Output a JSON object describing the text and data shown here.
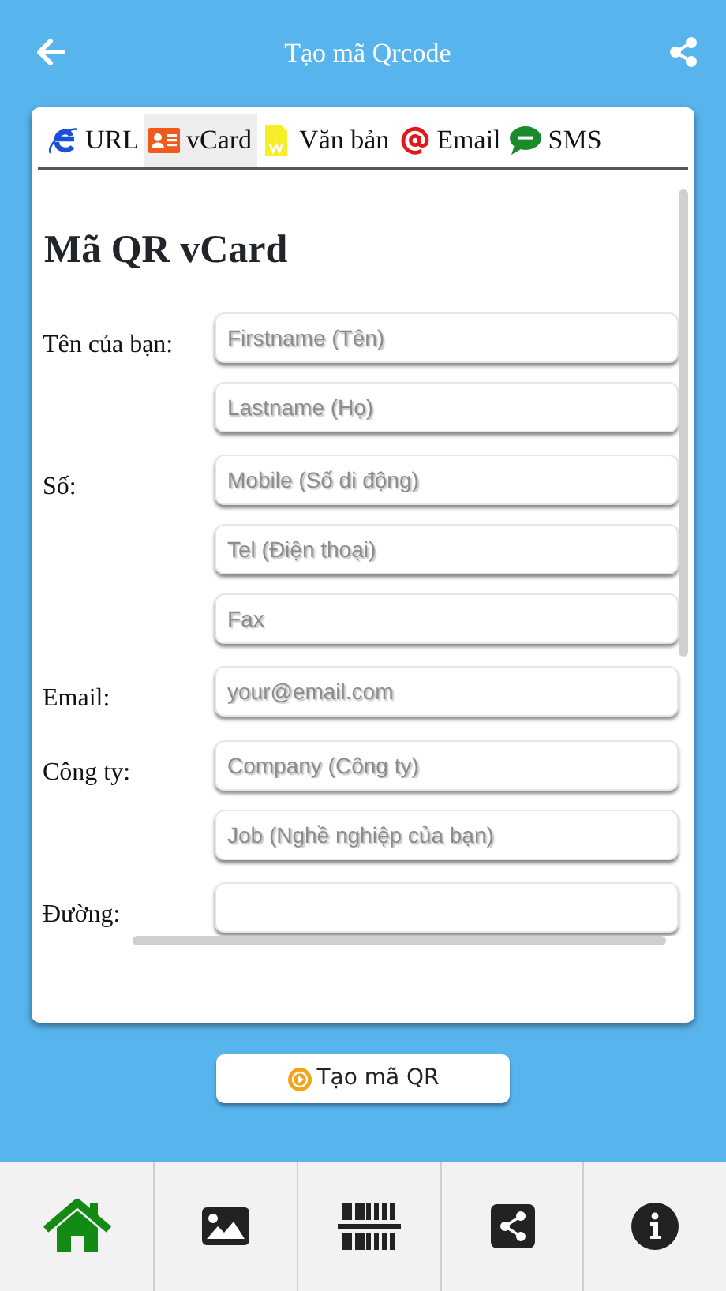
{
  "header": {
    "title": "Tạo mã Qrcode"
  },
  "tabs": [
    {
      "label": "URL",
      "kind": "web",
      "selected": false
    },
    {
      "label": "vCard",
      "kind": "card",
      "selected": true
    },
    {
      "label": "Văn bản",
      "kind": "doc",
      "selected": false
    },
    {
      "label": "Email",
      "kind": "at",
      "selected": false
    },
    {
      "label": "SMS",
      "kind": "sms",
      "selected": false
    }
  ],
  "form": {
    "heading": "Mã QR vCard",
    "groups": [
      {
        "label": "Tên của bạn:",
        "fields": [
          {
            "placeholder": "Firstname (Tên)"
          },
          {
            "placeholder": "Lastname (Họ)"
          }
        ]
      },
      {
        "label": "Số:",
        "fields": [
          {
            "placeholder": "Mobile (Số di động)"
          },
          {
            "placeholder": "Tel (Điện thoại)"
          },
          {
            "placeholder": "Fax"
          }
        ]
      },
      {
        "label": "Email:",
        "fields": [
          {
            "placeholder": "your@email.com"
          }
        ]
      },
      {
        "label": "Công ty:",
        "fields": [
          {
            "placeholder": "Company (Công ty)"
          },
          {
            "placeholder": "Job (Nghề nghiệp của bạn)"
          }
        ]
      },
      {
        "label": "Đường:",
        "fields": [
          {
            "kind": "text"
          }
        ]
      }
    ]
  },
  "action_button": {
    "label": "Tạo mã QR"
  },
  "bottom_nav": [
    {
      "kind": "home",
      "selected": true
    },
    {
      "kind": "image",
      "selected": false
    },
    {
      "kind": "barcode",
      "selected": false
    },
    {
      "kind": "share",
      "selected": false
    },
    {
      "kind": "info",
      "selected": false
    }
  ]
}
